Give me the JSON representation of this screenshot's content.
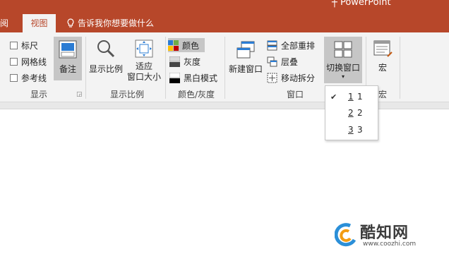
{
  "app": {
    "title": "┼  PowerPoint"
  },
  "tabs": [
    {
      "label": "阅"
    },
    {
      "label": "视图",
      "active": true
    }
  ],
  "tell_me": "告诉我你想要做什么",
  "groups": {
    "show": {
      "label": "显示",
      "checkboxes": [
        {
          "label": "标尺",
          "checked": false
        },
        {
          "label": "网格线",
          "checked": false
        },
        {
          "label": "参考线",
          "checked": false
        }
      ],
      "notes_button": "备注"
    },
    "zoom": {
      "label": "显示比例",
      "zoom_button": "显示比例",
      "fit_button_line1": "适应",
      "fit_button_line2": "窗口大小"
    },
    "color": {
      "label": "颜色/灰度",
      "items": [
        {
          "label": "颜色",
          "selected": true
        },
        {
          "label": "灰度"
        },
        {
          "label": "黑白模式"
        }
      ]
    },
    "window": {
      "label": "窗口",
      "new_window": "新建窗口",
      "arrange_all": "全部重排",
      "cascade": "层叠",
      "move_split": "移动拆分",
      "switch_windows": "切换窗口"
    },
    "macros": {
      "label": "宏",
      "macros_button": "宏"
    }
  },
  "switch_menu": {
    "items": [
      {
        "key": "1",
        "label": "1",
        "checked": true
      },
      {
        "key": "2",
        "label": "2"
      },
      {
        "key": "3",
        "label": "3"
      }
    ]
  },
  "watermark": {
    "brand": "酷知网",
    "url": "www.coozhi.com"
  },
  "colors": {
    "title_bar": "#b7472a",
    "ribbon": "#f3f3f3",
    "pressed": "#c6c6c6"
  }
}
